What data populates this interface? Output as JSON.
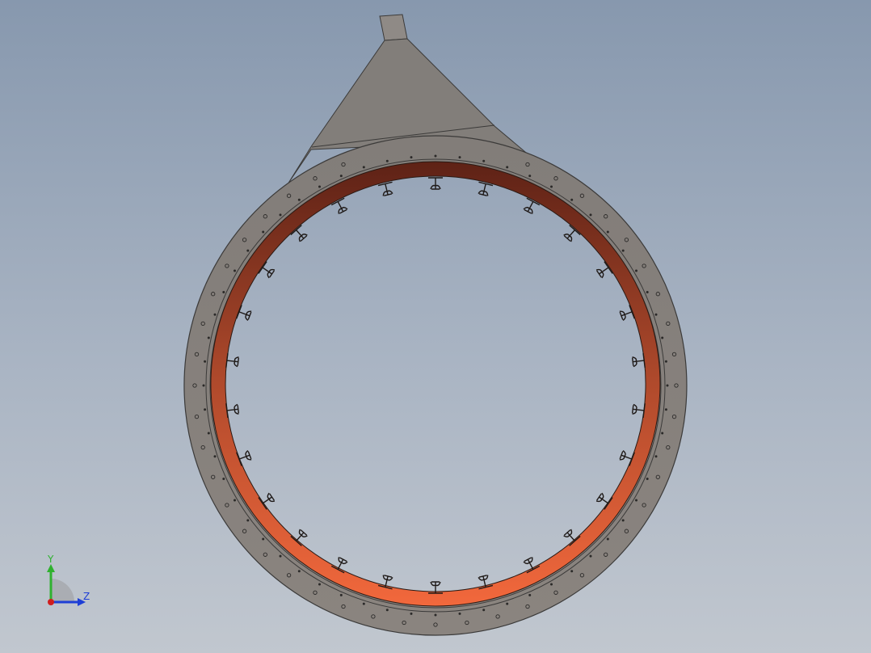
{
  "viewport": {
    "background_top": "#8798ae",
    "background_bottom": "#c1c7cf"
  },
  "model": {
    "flange_color": "#7f7b78",
    "flange_edge_color": "#3b3a39",
    "liner_color_top": "#5e2216",
    "liner_color_bottom": "#f2683c",
    "bolt_hole_count_outer": 48,
    "bolt_hole_count_inner": 60,
    "support_bracket_count": 26
  },
  "triad": {
    "y_label": "Y",
    "z_label": "Z",
    "y_color": "#2fb12f",
    "z_color": "#1e3fd6",
    "x_color": "#d01e1e"
  }
}
